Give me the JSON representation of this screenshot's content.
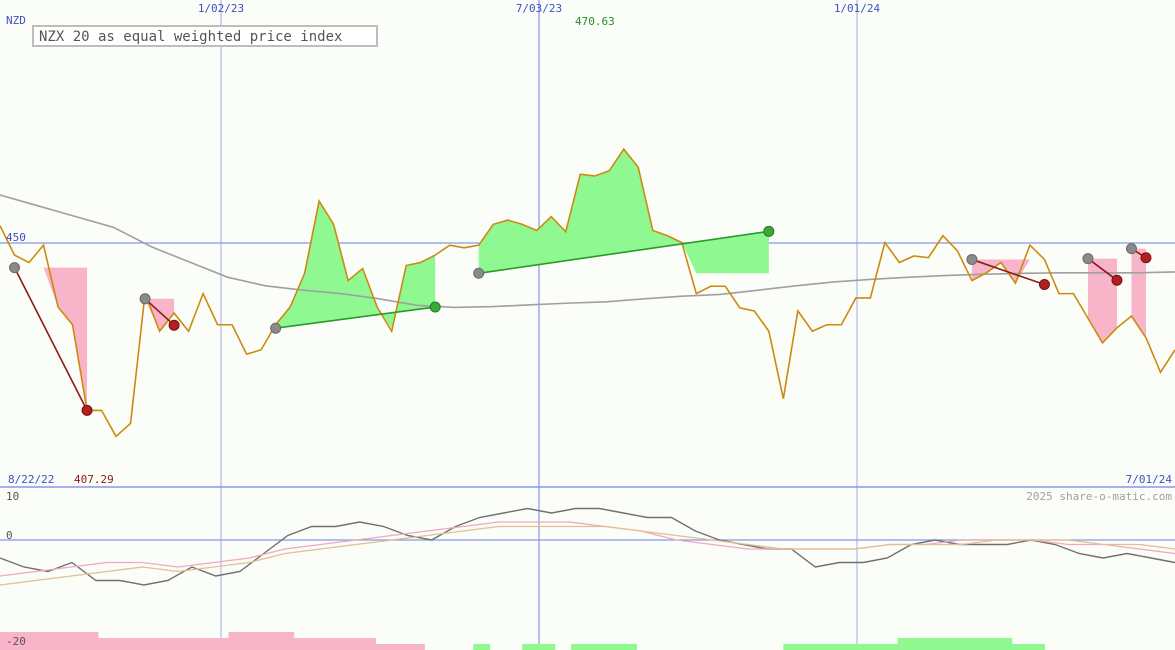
{
  "currency": "NZD",
  "title": "NZX 20 as equal weighted price index",
  "watermark": "2025 share-o-matic.com",
  "colors": {
    "price": "#cc8a10",
    "ma_main": "#a0a0a0",
    "gain_fill": "#90f890",
    "loss_fill": "#f8b4c8",
    "gain_line": "#2a9a2a",
    "loss_line": "#8b1a1a",
    "grid": "#8898e8",
    "osc_dark": "#707070",
    "osc_pink": "#f0a8c0",
    "osc_tan": "#e0c090",
    "label_blue": "#4050c0",
    "label_green": "#2a8a2a",
    "label_red": "#8b1a1a"
  },
  "chart_data": {
    "type": "line",
    "x_start_label": "8/22/22",
    "x_end_label": "7/01/24",
    "x_ticks": [
      "1/02/23",
      "7/03/23",
      "1/01/24"
    ],
    "y_reference": {
      "value": 450,
      "label": "450"
    },
    "high": {
      "value": 470.63,
      "label": "470.63"
    },
    "low": {
      "value": 407.29,
      "label": "407.29"
    },
    "price_series": [
      452.9,
      446.1,
      444.4,
      448.4,
      434.1,
      430.0,
      410.2,
      410.2,
      404.2,
      407.2,
      437.2,
      428.5,
      432.7,
      428.5,
      437.2,
      430.0,
      430.0,
      423.2,
      424.2,
      430.0,
      434.1,
      441.9,
      458.6,
      453.2,
      440.2,
      443.0,
      434.1,
      428.5,
      443.7,
      444.4,
      446.1,
      448.4,
      447.8,
      448.4,
      453.2,
      454.2,
      453.2,
      451.8,
      455.0,
      451.5,
      464.8,
      464.4,
      465.6,
      470.6,
      466.4,
      451.8,
      450.6,
      449.0,
      437.2,
      438.9,
      438.9,
      433.9,
      433.2,
      428.5,
      412.9,
      433.2,
      428.5,
      430.0,
      430.0,
      436.2,
      436.2,
      449.0,
      444.4,
      445.9,
      445.5,
      450.6,
      447.1,
      440.2,
      442.0,
      444.4,
      439.6,
      448.4,
      445.1,
      437.2,
      437.2,
      431.5,
      425.8,
      429.3,
      432.0,
      427.0,
      419.0,
      424.2
    ],
    "ma_series": [
      460.0,
      457.5,
      455.0,
      452.5,
      448.0,
      444.5,
      441.0,
      439.0,
      438.0,
      437.2,
      436.0,
      434.5,
      434.0,
      434.2,
      434.6,
      435.0,
      435.3,
      436.0,
      436.6,
      437.0,
      438.0,
      439.0,
      439.9,
      440.5,
      441.0,
      441.4,
      441.7,
      441.9,
      442.0,
      442.0,
      442.0,
      442.2
    ],
    "trades": [
      {
        "entry": 443.2,
        "exit": 410.2,
        "result": "loss"
      },
      {
        "entry": 436.0,
        "exit": 429.9,
        "result": "loss"
      },
      {
        "entry": 429.2,
        "exit": 434.1,
        "result": "gain"
      },
      {
        "entry": 441.9,
        "exit": 451.6,
        "result": "gain"
      },
      {
        "entry": 445.1,
        "exit": 439.3,
        "result": "loss"
      },
      {
        "entry": 445.3,
        "exit": 440.3,
        "result": "loss"
      },
      {
        "entry": 447.6,
        "exit": 445.5,
        "result": "loss"
      }
    ],
    "oscillator": {
      "y_ticks": [
        "10",
        "0",
        "-20"
      ],
      "series": [
        {
          "color_key": "osc_dark",
          "values": [
            -4,
            -6,
            -7,
            -5,
            -9,
            -9,
            -10,
            -9,
            -6,
            -8,
            -7,
            -3,
            1,
            3,
            3,
            4,
            3,
            1,
            0,
            3,
            5,
            6,
            7,
            6,
            7,
            7,
            6,
            5,
            5,
            2,
            0,
            -1,
            -2,
            -2,
            -6,
            -5,
            -5,
            -4,
            -1,
            0,
            -1,
            -1,
            -1,
            0,
            -1,
            -3,
            -4,
            -3,
            -4,
            -5
          ]
        },
        {
          "color_key": "osc_pink",
          "values": [
            -8,
            -7,
            -6,
            -5,
            -5,
            -6,
            -5,
            -4,
            -2,
            -1,
            0,
            1,
            2,
            3,
            4,
            4,
            4,
            3,
            2,
            0,
            -1,
            -2,
            -2,
            -2,
            -2,
            -1,
            -1,
            0,
            0,
            0,
            -1,
            -1,
            -2,
            -3
          ]
        },
        {
          "color_key": "osc_tan",
          "values": [
            -10,
            -9,
            -8,
            -7,
            -6,
            -7,
            -6,
            -5,
            -3,
            -2,
            -1,
            0,
            1,
            2,
            3,
            3,
            3,
            3,
            2,
            1,
            0,
            -1,
            -2,
            -2,
            -2,
            -1,
            -1,
            -1,
            0,
            0,
            0,
            -1,
            -1,
            -2
          ]
        }
      ],
      "histogram": [
        -3,
        -3,
        -3,
        -3,
        -3,
        -3,
        -2,
        -2,
        -2,
        -2,
        -2,
        -2,
        -2,
        -2,
        -3,
        -3,
        -3,
        -3,
        -2,
        -2,
        -2,
        -2,
        -2,
        -1,
        -1,
        -1,
        0,
        0,
        0,
        1,
        0,
        0,
        1,
        1,
        0,
        1,
        1,
        1,
        1,
        0,
        0,
        0,
        0,
        0,
        0,
        0,
        0,
        0,
        1,
        1,
        1,
        1,
        1,
        1,
        1,
        2,
        2,
        2,
        2,
        2,
        2,
        2,
        1,
        1,
        0,
        0,
        0,
        0,
        0,
        0,
        0,
        0
      ]
    }
  }
}
